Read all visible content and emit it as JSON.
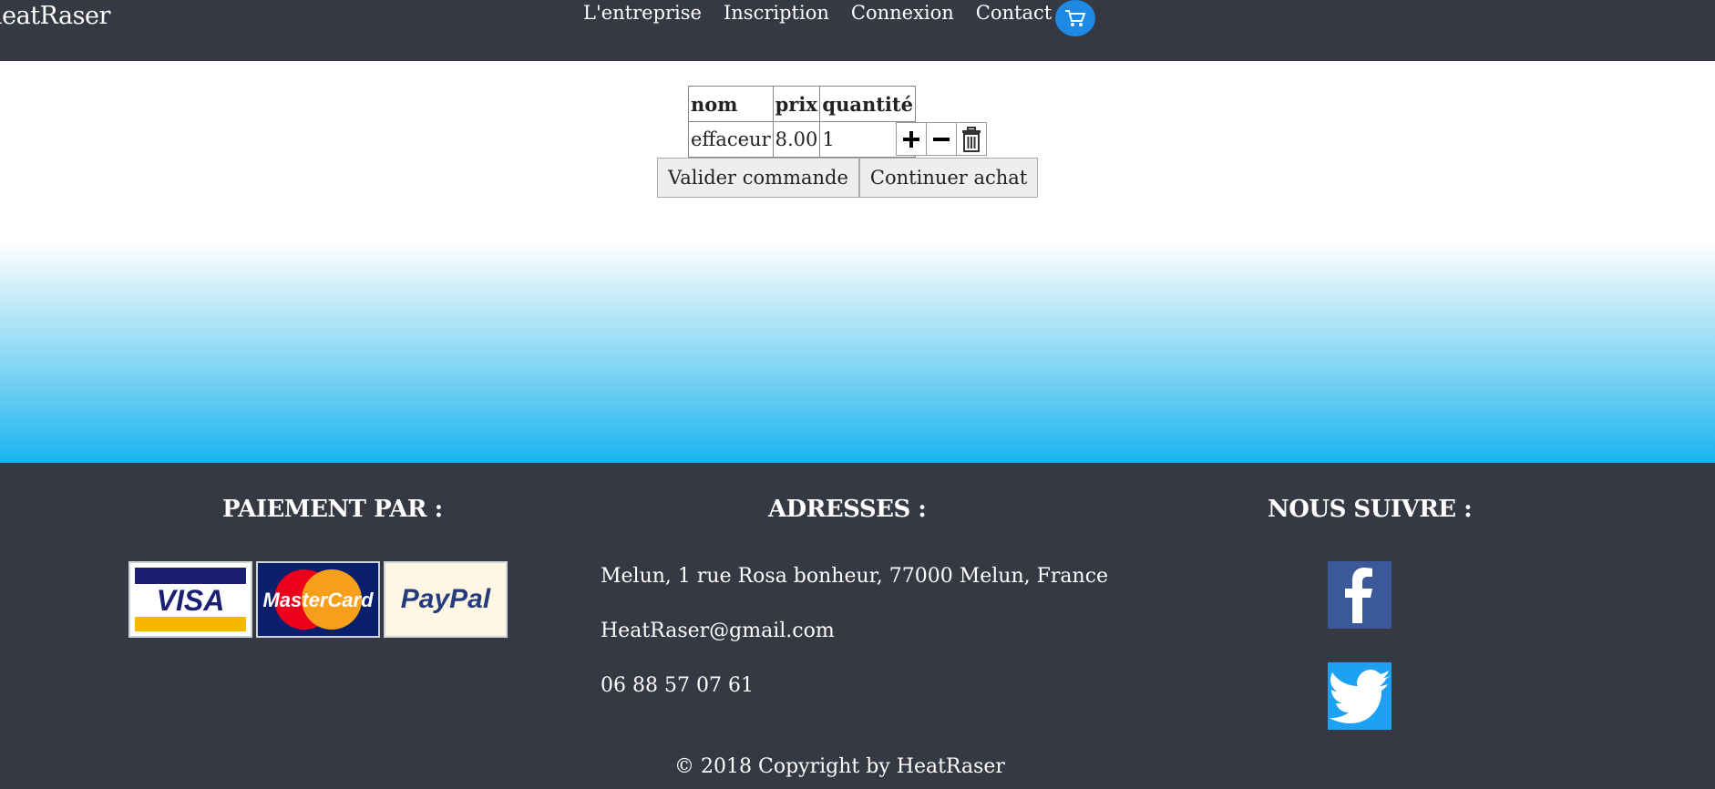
{
  "header": {
    "brand": "leatRaser",
    "nav": [
      "L'entreprise",
      "Inscription",
      "Connexion",
      "Contact"
    ]
  },
  "cart_table": {
    "columns": [
      "nom",
      "prix",
      "quantité"
    ],
    "rows": [
      {
        "nom": "effaceur",
        "prix": "8.00",
        "quantite": "1"
      }
    ]
  },
  "buttons": {
    "validate": "Valider commande",
    "continue": "Continuer achat"
  },
  "footer": {
    "payment_title": "PAIEMENT PAR :",
    "address_title": "ADRESSES :",
    "follow_title": "NOUS SUIVRE :",
    "address": "Melun, 1 rue Rosa bonheur, 77000 Melun, France",
    "email": "HeatRaser@gmail.com",
    "phone": "06 88 57 07 61",
    "cards": [
      "VISA",
      "MasterCard",
      "PayPal"
    ],
    "copyright": "© 2018 Copyright by HeatRaser"
  },
  "colors": {
    "header_bg": "#363943",
    "accent": "#1e88e5",
    "band_end": "#17b5ef",
    "facebook": "#3b5998",
    "twitter": "#1da1f2"
  }
}
